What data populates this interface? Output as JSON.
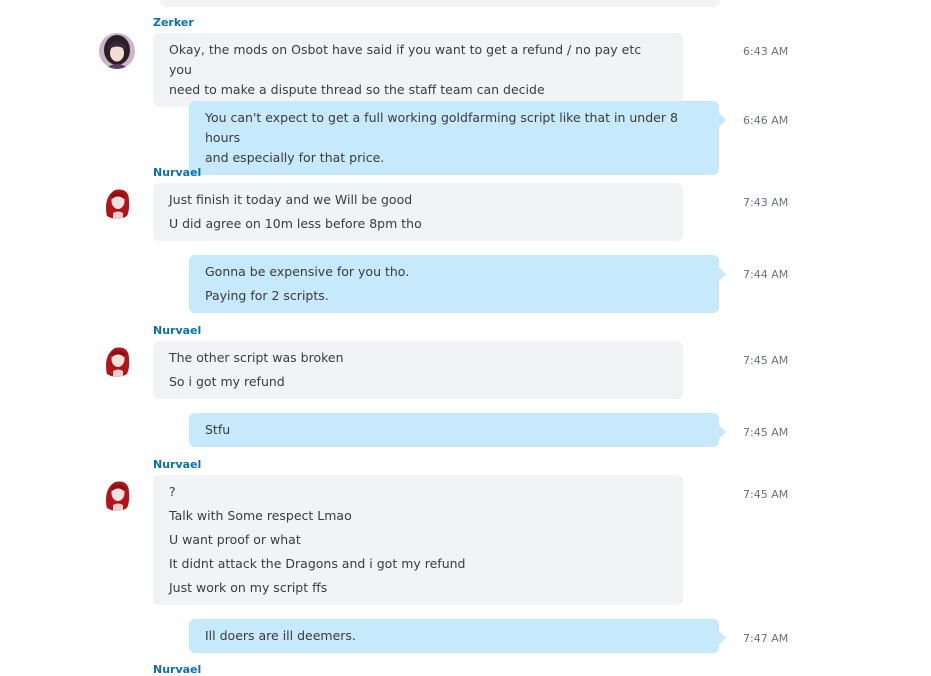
{
  "messages": [
    {
      "sender": "Zerker",
      "direction": "incoming",
      "avatar": "zerker-avatar",
      "time": "6:43 AM",
      "lines": [
        "Okay, the mods on Osbot have said if you want to get a refund / no pay etc you",
        "need to make a dispute thread so the staff team can decide"
      ]
    },
    {
      "direction": "outgoing",
      "time": "6:46 AM",
      "lines": [
        "You can't expect to get a full working goldfarming script like that in under 8 hours",
        "and especially for that price."
      ]
    },
    {
      "sender": "Nurvael",
      "direction": "incoming",
      "avatar": "nurvael-avatar",
      "time": "7:43 AM",
      "lines": [
        "Just finish it today and we Will be good",
        "U did agree on 10m less before 8pm tho"
      ]
    },
    {
      "direction": "outgoing",
      "time": "7:44 AM",
      "lines": [
        "Gonna be expensive for you tho.",
        "Paying for 2 scripts."
      ]
    },
    {
      "sender": "Nurvael",
      "direction": "incoming",
      "avatar": "nurvael-avatar",
      "time": "7:45 AM",
      "lines": [
        "The other script was broken",
        "So i got my refund"
      ]
    },
    {
      "direction": "outgoing",
      "time": "7:45 AM",
      "lines": [
        "Stfu"
      ]
    },
    {
      "sender": "Nurvael",
      "direction": "incoming",
      "avatar": "nurvael-avatar",
      "time": "7:45 AM",
      "lines": [
        "?",
        "Talk with Some respect Lmao",
        "U want proof or what",
        "It didnt attack the Dragons and i got my refund",
        "Just work on my script ffs"
      ]
    },
    {
      "direction": "outgoing",
      "time": "7:47 AM",
      "lines": [
        "Ill doers are ill deemers."
      ]
    }
  ],
  "trailing_sender": "Nurvael",
  "colors": {
    "incoming_bubble": "#f1f3f7",
    "outgoing_bubble": "#c6e9fb",
    "sender_name": "#0a6fb3",
    "timestamp": "#6b7380"
  }
}
